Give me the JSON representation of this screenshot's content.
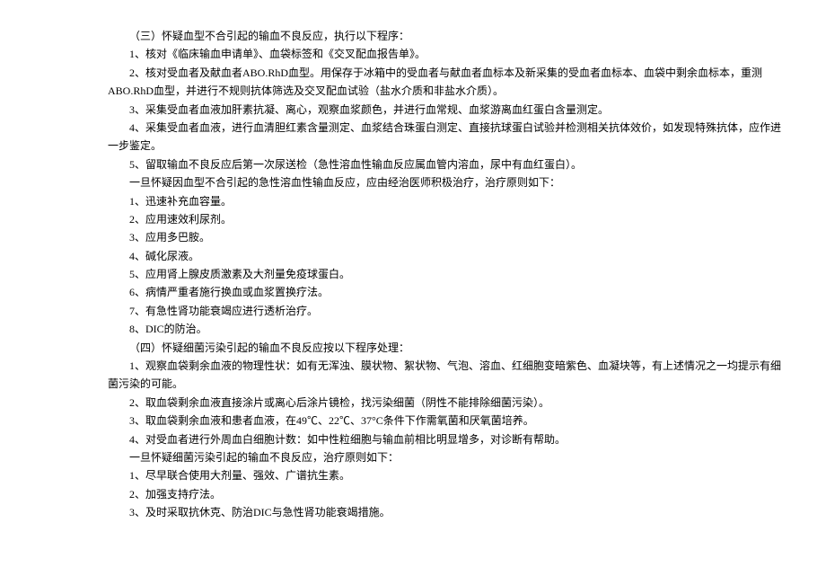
{
  "section3": {
    "title": "（三）怀疑血型不合引起的输血不良反应，执行以下程序：",
    "items": [
      "1、核对《临床输血申请单》、血袋标签和《交叉配血报告单》。",
      "2、核对受血者及献血者ABO.RhD血型。用保存于冰箱中的受血者与献血者血标本及新采集的受血者血标本、血袋中剩余血标本，重测ABO.RhD血型，并进行不规则抗体筛选及交叉配血试验（盐水介质和非盐水介质）。",
      "3、采集受血者血液加肝素抗凝、离心，观察血浆颜色，并进行血常规、血浆游离血红蛋白含量测定。",
      "4、采集受血者血液，进行血清胆红素含量测定、血浆结合珠蛋白测定、直接抗球蛋白试验并检测相关抗体效价，如发现特殊抗体，应作进一步鉴定。",
      "5、留取输血不良反应后第一次尿送检（急性溶血性输血反应属血管内溶血，尿中有血红蛋白）。"
    ],
    "subtitle": "一旦怀疑因血型不合引起的急性溶血性输血反应，应由经治医师积极治疗，治疗原则如下：",
    "subitems": [
      "1、迅速补充血容量。",
      "2、应用速效利尿剂。",
      "3、应用多巴胺。",
      "4、碱化尿液。",
      "5、应用肾上腺皮质激素及大剂量免疫球蛋白。",
      "6、病情严重者施行换血或血浆置换疗法。",
      "7、有急性肾功能衰竭应进行透析治疗。",
      "8、DIC的防治。"
    ]
  },
  "section4": {
    "title": "（四）怀疑细菌污染引起的输血不良反应按以下程序处理：",
    "items": [
      "1、观察血袋剩余血液的物理性状：如有无浑浊、膜状物、絮状物、气泡、溶血、红细胞变暗紫色、血凝块等，有上述情况之一均提示有细菌污染的可能。",
      "2、取血袋剩余血液直接涂片或离心后涂片镜检，找污染细菌（阴性不能排除细菌污染）。",
      "3、取血袋剩余血液和患者血液，在49℃、22℃、37°C条件下作需氧菌和厌氧菌培养。",
      "4、对受血者进行外周血白细胞计数：如中性粒细胞与输血前相比明显增多，对诊断有帮助。"
    ],
    "subtitle": "一旦怀疑细菌污染引起的输血不良反应，治疗原则如下：",
    "subitems": [
      "1、尽早联合使用大剂量、强效、广谱抗生素。",
      "2、加强支持疗法。",
      "3、及时采取抗休克、防治DIC与急性肾功能衰竭措施。"
    ]
  }
}
